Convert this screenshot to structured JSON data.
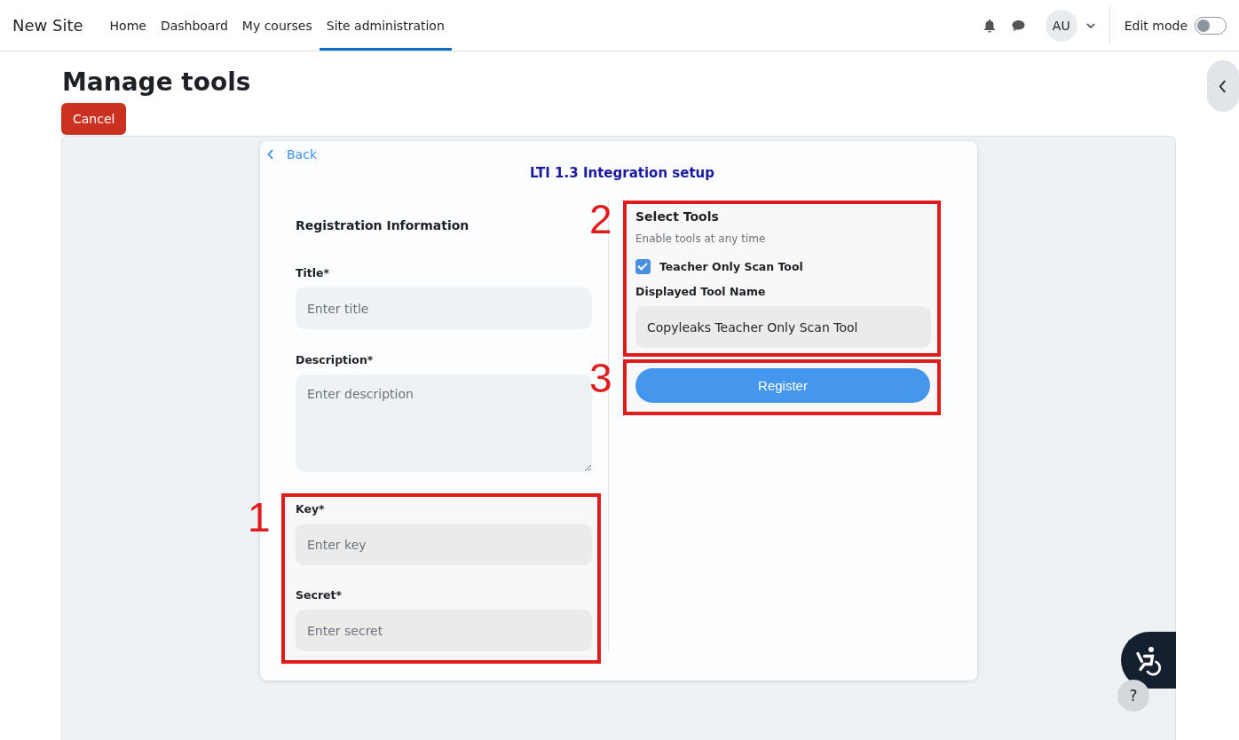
{
  "navbar": {
    "site_name": "New Site",
    "items": [
      {
        "label": "Home",
        "selected": false
      },
      {
        "label": "Dashboard",
        "selected": false
      },
      {
        "label": "My courses",
        "selected": false
      },
      {
        "label": "Site administration",
        "selected": true
      }
    ],
    "avatar": "AU",
    "edit_mode": {
      "label": "Edit mode",
      "on": false
    }
  },
  "page": {
    "title": "Manage tools",
    "cancel": "Cancel"
  },
  "card": {
    "back": "Back",
    "title": "LTI 1.3 Integration setup",
    "registration": {
      "heading": "Registration Information",
      "fields": [
        {
          "label": "Title*",
          "placeholder": "Enter title",
          "kind": "input"
        },
        {
          "label": "Description*",
          "placeholder": "Enter description",
          "kind": "textarea"
        }
      ],
      "marked_fields": {
        "number": "1",
        "fields": [
          {
            "label": "Key*",
            "placeholder": "Enter key",
            "kind": "input"
          },
          {
            "label": "Secret*",
            "placeholder": "Enter secret",
            "kind": "input"
          }
        ]
      }
    },
    "tools": {
      "number": "2",
      "heading": "Select Tools",
      "hint": "Enable tools at any time",
      "tool": {
        "label": "Teacher Only Scan Tool",
        "checked": true
      },
      "name_label": "Displayed Tool Name",
      "name_value": "Copyleaks Teacher Only Scan Tool"
    },
    "register": {
      "number": "3",
      "label": "Register"
    }
  },
  "help": "?"
}
